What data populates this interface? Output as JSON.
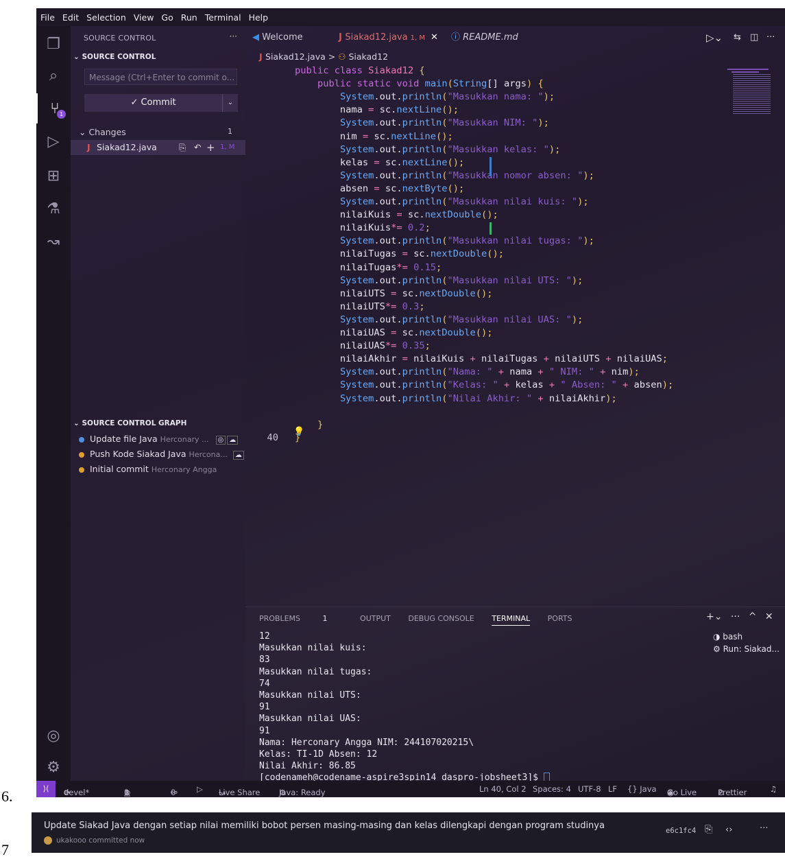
{
  "page_labels": [
    "6.",
    "7"
  ],
  "menu": [
    "File",
    "Edit",
    "Selection",
    "View",
    "Go",
    "Run",
    "Terminal",
    "Help"
  ],
  "sidebar": {
    "title": "SOURCE CONTROL",
    "section": "SOURCE CONTROL",
    "message_placeholder": "Message (Ctrl+Enter to commit o...",
    "commit_label": "✓ Commit",
    "changes_label": "Changes",
    "changes_count": "1",
    "file_name": "Siakad12.java",
    "file_status": "1, M",
    "graph_title": "SOURCE CONTROL GRAPH",
    "graph": [
      {
        "msg": "Update file Java",
        "author": "Herconary ...",
        "color": "#4f8fe0"
      },
      {
        "msg": "Push Kode Siakad Java",
        "author": "Hercona...",
        "color": "#e0a030"
      },
      {
        "msg": "Initial commit",
        "author": "Herconary Angga",
        "color": "#e0a030"
      }
    ],
    "activity_badge": "1"
  },
  "tabs": [
    {
      "label": "Welcome",
      "icon": "vscode-icon"
    },
    {
      "label": "Siakad12.java",
      "status": "1, M",
      "icon": "java-icon"
    },
    {
      "label": "README.md",
      "icon": "info-icon"
    }
  ],
  "breadcrumb": {
    "file": "Siakad12.java",
    "sep": ">",
    "symbol": "Siakad12"
  },
  "code": {
    "visible_line_number": "40",
    "lines": [
      "public class Siakad12 {",
      "    public static void main(String[] args) {",
      "        System.out.println(\"Masukkan nama: \");",
      "        nama = sc.nextLine();",
      "        System.out.println(\"Masukkan NIM: \");",
      "        nim = sc.nextLine();",
      "        System.out.println(\"Masukkan kelas: \");",
      "        kelas = sc.nextLine();",
      "        System.out.println(\"Masukkan nomor absen: \");",
      "        absen = sc.nextByte();",
      "        System.out.println(\"Masukkan nilai kuis: \");",
      "        nilaiKuis = sc.nextDouble();",
      "        nilaiKuis*= 0.2;",
      "        System.out.println(\"Masukkan nilai tugas: \");",
      "        nilaiTugas = sc.nextDouble();",
      "        nilaiTugas*= 0.15;",
      "        System.out.println(\"Masukkan nilai UTS: \");",
      "        nilaiUTS = sc.nextDouble();",
      "        nilaiUTS*= 0.3;",
      "        System.out.println(\"Masukkan nilai UAS: \");",
      "        nilaiUAS = sc.nextDouble();",
      "        nilaiUAS*= 0.35;",
      "        nilaiAkhir = nilaiKuis + nilaiTugas + nilaiUTS + nilaiUAS;",
      "        System.out.println(\"Nama: \" + nama + \" NIM: \" + nim);",
      "        System.out.println(\"Kelas: \" + kelas + \" Absen: \" + absen);",
      "        System.out.println(\"Nilai Akhir: \" + nilaiAkhir);",
      "",
      "    }",
      "}"
    ]
  },
  "panel": {
    "tabs": [
      "PROBLEMS",
      "OUTPUT",
      "DEBUG CONSOLE",
      "TERMINAL",
      "PORTS"
    ],
    "problems_count": "1",
    "active_tab": "TERMINAL",
    "terminal_lines": [
      "12",
      "Masukkan nilai kuis:",
      "83",
      "Masukkan nilai tugas:",
      "74",
      "Masukkan nilai UTS:",
      "91",
      "Masukkan nilai UAS:",
      "91",
      "Nama: Herconary Angga NIM: 244107020215\\",
      "Kelas: TI-1D Absen: 12",
      "Nilai Akhir: 86.85",
      "[codenameh@codename-aspire3spin14 daspro-jobsheet3]$ "
    ],
    "terminals": [
      "bash",
      "Run: Siakad..."
    ]
  },
  "status": {
    "branch": "devel*",
    "errors": "0",
    "warnings": "1",
    "ports": "0",
    "live_share": "Live Share",
    "java": "Java: Ready",
    "position": "Ln 40, Col 2",
    "spaces": "Spaces: 4",
    "encoding": "UTF-8",
    "eol": "LF",
    "language": "{} Java",
    "go_live": "Go Live",
    "prettier": "Prettier"
  },
  "commit_popup": {
    "message": "Update Siakad Java dengan setiap nilai memiliki bobot persen masing-masing dan kelas dilengkapi dengan program studinya",
    "author_line": "ukakooo committed now",
    "hash": "e6c1fc4"
  }
}
